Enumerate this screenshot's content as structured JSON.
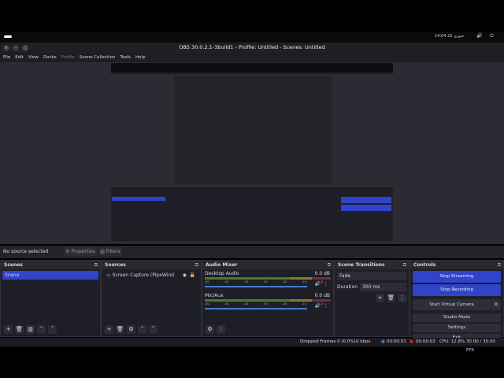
{
  "panel": {
    "clock": "14:04",
    "date": "22 جنوری"
  },
  "window": {
    "title": "OBS 30.0.2.1-3build1 - Profile: Untitled - Scenes: Untitled"
  },
  "menu": [
    "File",
    "Edit",
    "View",
    "Docks",
    "Profile",
    "Scene Collection",
    "Tools",
    "Help"
  ],
  "source_bar": {
    "status": "No source selected",
    "properties": "Properties",
    "filters": "Filters"
  },
  "scenes": {
    "title": "Scenes",
    "items": [
      "Scene"
    ]
  },
  "sources": {
    "title": "Sources",
    "items": [
      "Screen Capture (PipeWire)"
    ]
  },
  "mixer": {
    "title": "Audio Mixer",
    "channels": [
      {
        "name": "Desktop Audio",
        "db": "0.0 dB"
      },
      {
        "name": "Mic/Aux",
        "db": "0.0 dB"
      }
    ],
    "ticks": [
      "-60",
      "-55",
      "-50",
      "-45",
      "-40",
      "-35",
      "-30",
      "-25",
      "-20",
      "-15",
      "-10",
      "-5",
      "0"
    ]
  },
  "transitions": {
    "title": "Scene Transitions",
    "selected": "Fade",
    "duration_label": "Duration",
    "duration": "300 ms"
  },
  "controls": {
    "title": "Controls",
    "stop_streaming": "Stop Streaming",
    "stop_recording": "Stop Recording",
    "virtual_camera": "Start Virtual Camera",
    "studio_mode": "Studio Mode",
    "settings": "Settings",
    "exit": "Exit"
  },
  "status": {
    "dropped": "Dropped Frames 0 (0.0%)",
    "kbps": "0 kbps",
    "stream_time": "00:00:01",
    "rec_time": "00:00:03",
    "cpu": "CPU: 12.8%",
    "fps": "30.00 / 30.00 FPS"
  }
}
